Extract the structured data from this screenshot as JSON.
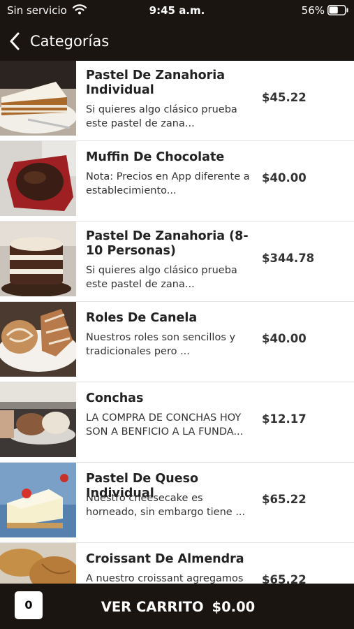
{
  "status_bar": {
    "carrier": "Sin servicio",
    "time": "9:45 a.m.",
    "battery": "56%",
    "battery_level": 0.56
  },
  "nav": {
    "back_label": "Categorías",
    "back_icon": "chevron-left-icon"
  },
  "products": [
    {
      "name": "Pastel De Zanahoria Individual",
      "description": "Si quieres algo clásico prueba este pastel de zana...",
      "price": "$45.22",
      "image": "carrot-cake-slice-photo"
    },
    {
      "name": "Muffin De Chocolate",
      "description": "Nota: Precios en App diferente a establecimiento...",
      "price": "$40.00",
      "image": "chocolate-muffin-photo"
    },
    {
      "name": "Pastel De Zanahoria (8-10 Personas)",
      "description": "Si quieres algo clásico prueba este pastel de zana...",
      "price": "$344.78",
      "image": "carrot-cake-whole-photo"
    },
    {
      "name": "Roles De Canela",
      "description": "Nuestros roles son sencillos y tradicionales pero ...",
      "price": "$40.00",
      "image": "cinnamon-rolls-photo"
    },
    {
      "name": "Conchas",
      "description": "LA COMPRA DE CONCHAS HOY SON A BENFICIO A LA FUNDA...",
      "price": "$12.17",
      "image": "conchas-photo"
    },
    {
      "name": "Pastel De Queso Individual",
      "description": "Nuestro cheesecake es horneado, sin embargo tiene ...",
      "price": "$65.22",
      "image": "cheesecake-slice-photo"
    },
    {
      "name": "Croissant De Almendra",
      "description": "A nuestro croissant agregamos",
      "price": "$65.22",
      "image": "almond-croissant-photo"
    }
  ],
  "cart": {
    "count": "0",
    "label": "VER CARRITO",
    "total": "$0.00"
  }
}
